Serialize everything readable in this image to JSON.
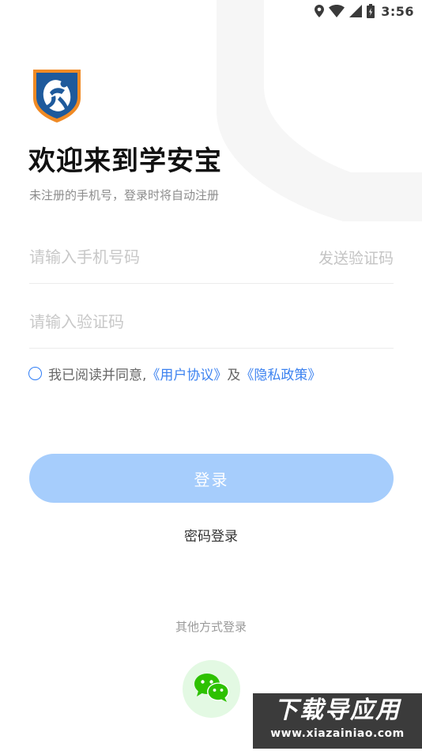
{
  "status_bar": {
    "time": "3:56",
    "icons": [
      "location-icon",
      "wifi-icon",
      "signal-icon",
      "battery-icon"
    ]
  },
  "app": {
    "logo": "xueanbao-logo",
    "welcome_title": "欢迎来到学安宝",
    "subtitle": "未注册的手机号，登录时将自动注册"
  },
  "form": {
    "phone_placeholder": "请输入手机号码",
    "send_code_label": "发送验证码",
    "code_placeholder": "请输入验证码",
    "agreement": {
      "prefix": "我已阅读并同意,",
      "user_agreement": "《用户协议》",
      "conjunction": "及",
      "privacy_policy": "《隐私政策》"
    },
    "login_label": "登录",
    "password_login_label": "密码登录"
  },
  "other_login": {
    "label": "其他方式登录",
    "wechat_icon": "wechat-icon"
  },
  "watermark": {
    "main": "下载导应用",
    "sub": "www.xiazainiao.com"
  },
  "colors": {
    "accent": "#3c82f0",
    "login_button": "#a6cdfc",
    "wechat_bg": "#e3f9e3",
    "wechat_green": "#2dc100"
  }
}
